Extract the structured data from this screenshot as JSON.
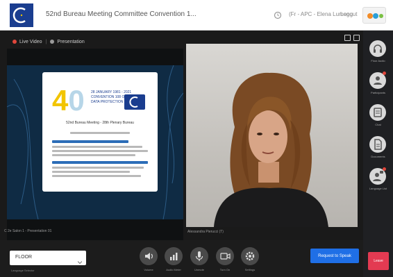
{
  "header": {
    "meeting_title": "52nd Bureau Meeting Committee Convention 1...",
    "user": "(Fr - APC - Elena Lumeng",
    "logout": "Logout"
  },
  "stage": {
    "live_video_tab": "Live Video",
    "presentation_tab": "Presentation"
  },
  "slide": {
    "big_number": "40",
    "convention_text": "28 JANUARY 1981 - 2021 CONVENTION 108 ON DATA PROTECTION",
    "heading": "52nd Bureau Meeting - 28th Plenary Bureau"
  },
  "captions": {
    "presenter": "C 2e Salon 1 - Presentation 01",
    "speaker": "Alessandra Pierucci (T)"
  },
  "sidebar": {
    "items": [
      {
        "label": "Floor Audio",
        "icon": "headset-icon"
      },
      {
        "label": "Participants",
        "icon": "participants-icon"
      },
      {
        "label": "Chat",
        "icon": "chat-icon"
      },
      {
        "label": "Documents",
        "icon": "document-icon"
      },
      {
        "label": "Language List",
        "icon": "language-icon"
      }
    ]
  },
  "bottom": {
    "language_value": "FLOOR",
    "language_caption": "Language Selector",
    "controls": [
      {
        "label": "Volume",
        "icon": "speaker-icon"
      },
      {
        "label": "Audio Meter",
        "icon": "signal-bars-icon"
      },
      {
        "label": "Unmute",
        "icon": "microphone-icon"
      },
      {
        "label": "Turn On",
        "icon": "camera-icon"
      },
      {
        "label": "Settings",
        "icon": "gear-icon"
      }
    ],
    "request_button": "Request to Speak",
    "leave_button": "Leave"
  },
  "colors": {
    "accent_blue": "#1f6fe6",
    "leave_red": "#e33a52",
    "coe_blue": "#1a3d8f",
    "slide_yellow": "#f2c500"
  }
}
